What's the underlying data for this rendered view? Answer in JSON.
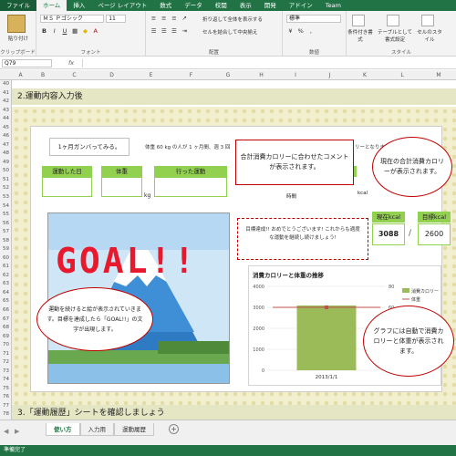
{
  "ribbon_tabs": [
    "ファイル",
    "ホーム",
    "挿入",
    "ページ レイアウト",
    "数式",
    "データ",
    "校閲",
    "表示",
    "開発",
    "アドイン",
    "Team"
  ],
  "ribbon": {
    "paste": "貼り付け",
    "clipboard": "クリップボード",
    "font_name": "ＭＳ Ｐゴシック",
    "font_size": "11",
    "font_group": "フォント",
    "wrap": "折り返して全体を表示する",
    "merge": "セルを結合して中央揃え",
    "align_group": "配置",
    "number_format": "標準",
    "number_group": "数値",
    "cond": "条件付き書式",
    "table": "テーブルとして書式設定",
    "style": "セルのスタイル",
    "style_group": "スタイル"
  },
  "formula_bar": {
    "name_box": "Q79",
    "fx": "fx"
  },
  "columns": [
    "A",
    "B",
    "C",
    "D",
    "E",
    "F",
    "G",
    "H",
    "I",
    "J",
    "K",
    "L",
    "M"
  ],
  "rows": [
    "40",
    "41",
    "42",
    "43",
    "44",
    "45",
    "46",
    "47",
    "48",
    "49",
    "50",
    "51",
    "52",
    "53",
    "54",
    "55",
    "56",
    "57",
    "58",
    "59",
    "60",
    "61",
    "62",
    "63",
    "64",
    "65",
    "66",
    "67",
    "68",
    "69",
    "70",
    "71",
    "72",
    "73",
    "74",
    "75",
    "76",
    "77",
    "78"
  ],
  "section2_title": "2.運動内容入力後",
  "section3_title": "3.「運動履歴」シートを確認しましょう",
  "goal_text": "1ヶ月ガンバってみる。",
  "sentence": "体重 60 kg の人が 1 ヶ月間、週 3 回",
  "sentence_tail": "リーとなります。",
  "headers": {
    "date": "運動した日",
    "weight": "体重",
    "exercise": "行った運動"
  },
  "units": {
    "kg": "kg",
    "time": "時間",
    "kcal": "kcal"
  },
  "message": "目標達成!! おめでとうございます! これからも適度な運動を継続し続けましょう!",
  "current": {
    "label": "現在kcal",
    "value": "3088"
  },
  "target": {
    "label": "目標kcal",
    "value": "2600"
  },
  "slash": "/",
  "goal_art": "GOAL!!",
  "chart_data": {
    "type": "bar",
    "title": "消費カロリーと体重の推移",
    "categories": [
      "2013/1/1"
    ],
    "series": [
      {
        "name": "消費カロリー",
        "type": "bar",
        "values": [
          3088
        ]
      },
      {
        "name": "体重",
        "type": "line",
        "values": [
          60
        ]
      }
    ],
    "y_left": {
      "ticks": [
        "0",
        "1000",
        "2000",
        "3000",
        "4000"
      ],
      "ylim": [
        0,
        4000
      ]
    },
    "y_right": {
      "ticks": [
        "0",
        "20",
        "40",
        "60",
        "80"
      ],
      "ylim": [
        0,
        80
      ]
    },
    "legend": "right",
    "colors": {
      "bar": "#9bbb59",
      "line": "#c0504d"
    }
  },
  "callouts": {
    "comment": "合計消費カロリーに合わせたコメントが表示されます。",
    "total": "現在の合計消費カロリーが表示されます。",
    "goal": "運動を続けると絵が表示されていきます。目標を達成したら「GOAL!!」の文字が出現します。",
    "graph": "グラフには自動で消費カロリーと体重が表示されます。"
  },
  "sheet_tabs": [
    "使い方",
    "入力用",
    "運動履歴"
  ],
  "status": "準備完了",
  "colors": {
    "excel_green": "#217346",
    "cell_green": "#92d050",
    "callout_red": "#c00000",
    "accent_red": "#e8192c"
  }
}
